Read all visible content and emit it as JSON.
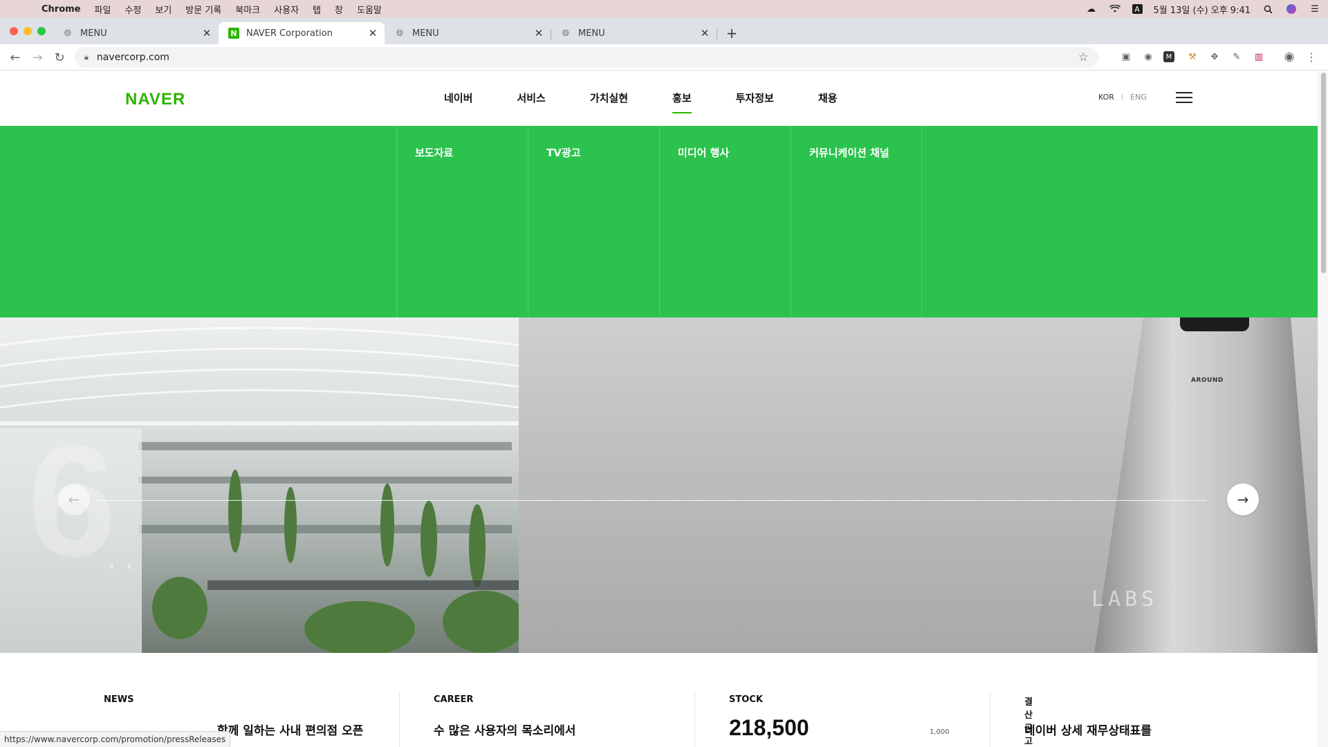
{
  "menubar": {
    "app": "Chrome",
    "items": [
      "파일",
      "수정",
      "보기",
      "방문 기록",
      "북마크",
      "사용자",
      "탭",
      "창",
      "도움말"
    ],
    "clock": "5월 13일 (수) 오후 9:41",
    "input_badge": "A"
  },
  "tabs": [
    {
      "label": "MENU",
      "icon": "globe-icon"
    },
    {
      "label": "NAVER Corporation",
      "icon": "naver-favicon"
    },
    {
      "label": "MENU",
      "icon": "globe-icon"
    },
    {
      "label": "MENU",
      "icon": "globe-icon"
    }
  ],
  "address": {
    "url": "navercorp.com"
  },
  "site": {
    "logo": "NAVER",
    "nav": [
      "네이버",
      "서비스",
      "가치실현",
      "홍보",
      "투자정보",
      "채용"
    ],
    "active_nav": "홍보",
    "lang": {
      "kor": "KOR",
      "sep": "I",
      "eng": "ENG"
    },
    "submenu": [
      "보도자료",
      "TV광고",
      "미디어 행사",
      "커뮤니케이션 채널"
    ],
    "brand_color": "#2bc34d"
  },
  "hero": {
    "robot_brand": "AROUND",
    "labs_mark": "LABS",
    "big_digit": "6",
    "slide_no": "4  4"
  },
  "bottom": {
    "news": {
      "head": "NEWS",
      "body": "함께 일하는 사내 편의점 오픈"
    },
    "career": {
      "head": "CAREER",
      "body": "수 많은 사용자의 목소리에서"
    },
    "stock": {
      "head": "STOCK",
      "price": "218,500",
      "change": "1,000"
    },
    "notice": {
      "head": "결산공고",
      "body": "네이버 상세 재무상태표를"
    }
  },
  "status_url": "https://www.navercorp.com/promotion/pressReleases"
}
